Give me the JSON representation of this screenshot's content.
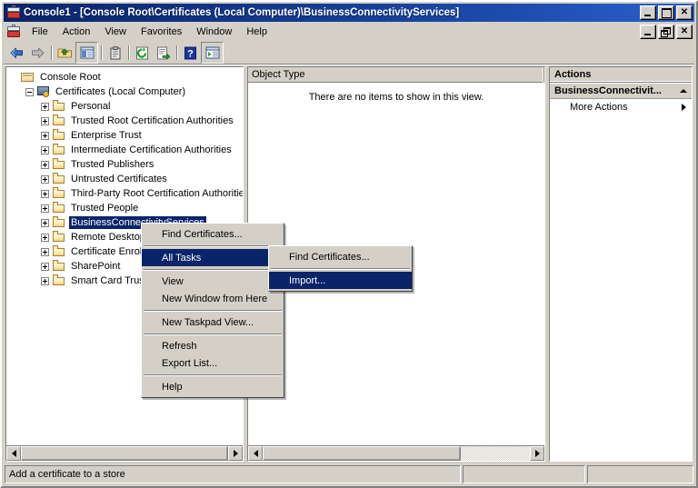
{
  "window": {
    "title": "Console1 - [Console Root\\Certificates (Local Computer)\\BusinessConnectivityServices]",
    "icon": "mmc-console-icon",
    "controls": {
      "minimize": "_",
      "maximize": "□",
      "close": "✕"
    },
    "mdi_controls": {
      "minimize": "_",
      "restore": "❐",
      "close": "✕"
    }
  },
  "menubar": {
    "items": [
      {
        "label": "File"
      },
      {
        "label": "Action"
      },
      {
        "label": "View"
      },
      {
        "label": "Favorites"
      },
      {
        "label": "Window"
      },
      {
        "label": "Help"
      }
    ]
  },
  "toolbar": {
    "buttons": [
      {
        "name": "back-icon",
        "tip": "Back"
      },
      {
        "name": "forward-icon",
        "tip": "Forward"
      },
      {
        "name": "up-one-level-icon",
        "tip": "Up One Level"
      },
      {
        "name": "show-hide-console-tree-icon",
        "tip": "Show/Hide Console Tree",
        "pressed": true
      },
      {
        "name": "properties-icon",
        "tip": "Properties"
      },
      {
        "name": "refresh-icon",
        "tip": "Refresh"
      },
      {
        "name": "export-list-icon",
        "tip": "Export List"
      },
      {
        "name": "help-icon",
        "tip": "Help"
      },
      {
        "name": "show-hide-action-pane-icon",
        "tip": "Show/Hide Action Pane",
        "pressed": true
      }
    ]
  },
  "tree": {
    "nodes": [
      {
        "label": "Console Root",
        "indent": 0,
        "expander": "none",
        "icon": "root-folder-icon",
        "selected": false
      },
      {
        "label": "Certificates (Local Computer)",
        "indent": 1,
        "expander": "minus",
        "icon": "certificates-icon",
        "selected": false
      },
      {
        "label": "Personal",
        "indent": 2,
        "expander": "plus",
        "icon": "folder-icon",
        "selected": false
      },
      {
        "label": "Trusted Root Certification Authorities",
        "indent": 2,
        "expander": "plus",
        "icon": "folder-icon",
        "selected": false
      },
      {
        "label": "Enterprise Trust",
        "indent": 2,
        "expander": "plus",
        "icon": "folder-icon",
        "selected": false
      },
      {
        "label": "Intermediate Certification Authorities",
        "indent": 2,
        "expander": "plus",
        "icon": "folder-icon",
        "selected": false
      },
      {
        "label": "Trusted Publishers",
        "indent": 2,
        "expander": "plus",
        "icon": "folder-icon",
        "selected": false
      },
      {
        "label": "Untrusted Certificates",
        "indent": 2,
        "expander": "plus",
        "icon": "folder-icon",
        "selected": false
      },
      {
        "label": "Third-Party Root Certification Authorities",
        "indent": 2,
        "expander": "plus",
        "icon": "folder-icon",
        "selected": false
      },
      {
        "label": "Trusted People",
        "indent": 2,
        "expander": "plus",
        "icon": "folder-icon",
        "selected": false
      },
      {
        "label": "BusinessConnectivityServices",
        "indent": 2,
        "expander": "plus",
        "icon": "folder-icon",
        "selected": true
      },
      {
        "label": "Remote Desktop",
        "indent": 2,
        "expander": "plus",
        "icon": "folder-icon",
        "selected": false
      },
      {
        "label": "Certificate Enrollment Requests",
        "indent": 2,
        "expander": "plus",
        "icon": "folder-icon",
        "selected": false
      },
      {
        "label": "SharePoint",
        "indent": 2,
        "expander": "plus",
        "icon": "folder-icon",
        "selected": false
      },
      {
        "label": "Smart Card Trusted Roots",
        "indent": 2,
        "expander": "plus",
        "icon": "folder-icon",
        "selected": false
      }
    ]
  },
  "list": {
    "columns": [
      {
        "label": "Object Type"
      }
    ],
    "empty_message": "There are no items to show in this view.",
    "rows": []
  },
  "actions": {
    "title": "Actions",
    "group_label": "BusinessConnectivit...",
    "collapse_icon": "caret-up-icon",
    "items": [
      {
        "label": "More Actions",
        "has_submenu": true
      }
    ]
  },
  "context_menu": {
    "items": [
      {
        "label": "Find Certificates...",
        "type": "item",
        "highlighted": false,
        "submenu": false
      },
      {
        "label": "",
        "type": "separator"
      },
      {
        "label": "All Tasks",
        "type": "item",
        "highlighted": true,
        "submenu": true
      },
      {
        "label": "",
        "type": "separator"
      },
      {
        "label": "View",
        "type": "item",
        "highlighted": false,
        "submenu": true
      },
      {
        "label": "New Window from Here",
        "type": "item",
        "highlighted": false,
        "submenu": false
      },
      {
        "label": "",
        "type": "separator"
      },
      {
        "label": "New Taskpad View...",
        "type": "item",
        "highlighted": false,
        "submenu": false
      },
      {
        "label": "",
        "type": "separator"
      },
      {
        "label": "Refresh",
        "type": "item",
        "highlighted": false,
        "submenu": false
      },
      {
        "label": "Export List...",
        "type": "item",
        "highlighted": false,
        "submenu": false
      },
      {
        "label": "",
        "type": "separator"
      },
      {
        "label": "Help",
        "type": "item",
        "highlighted": false,
        "submenu": false
      }
    ]
  },
  "submenu": {
    "items": [
      {
        "label": "Find Certificates...",
        "type": "item",
        "highlighted": false
      },
      {
        "label": "",
        "type": "separator"
      },
      {
        "label": "Import...",
        "type": "item",
        "highlighted": true
      }
    ]
  },
  "statusbar": {
    "message": "Add a certificate to a store",
    "cell2": "",
    "cell3": ""
  },
  "colors": {
    "title_bar_start": "#0a246a",
    "title_bar_end": "#2a5fcc",
    "selection": "#0a246a",
    "face": "#d4d0c8",
    "window": "#ffffff",
    "shadow": "#808080"
  }
}
